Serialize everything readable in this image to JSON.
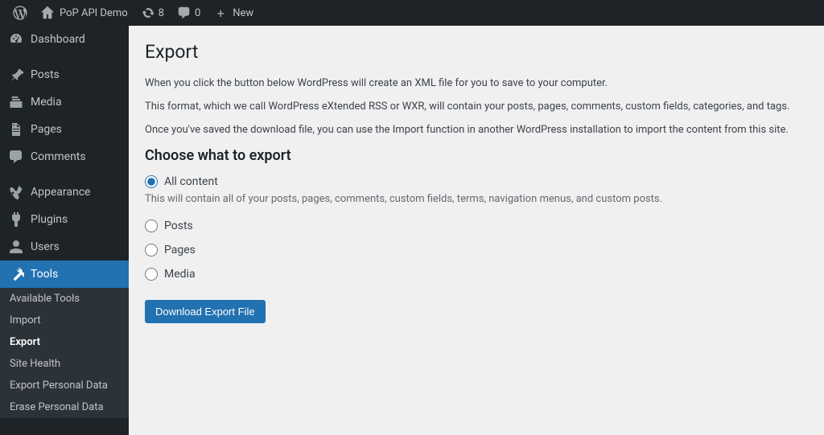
{
  "adminbar": {
    "site_name": "PoP API Demo",
    "updates_count": "8",
    "comments_count": "0",
    "new_label": "New"
  },
  "sidebar": {
    "items": [
      {
        "label": "Dashboard"
      },
      {
        "label": "Posts"
      },
      {
        "label": "Media"
      },
      {
        "label": "Pages"
      },
      {
        "label": "Comments"
      },
      {
        "label": "Appearance"
      },
      {
        "label": "Plugins"
      },
      {
        "label": "Users"
      },
      {
        "label": "Tools"
      }
    ],
    "submenu": [
      {
        "label": "Available Tools"
      },
      {
        "label": "Import"
      },
      {
        "label": "Export"
      },
      {
        "label": "Site Health"
      },
      {
        "label": "Export Personal Data"
      },
      {
        "label": "Erase Personal Data"
      }
    ]
  },
  "main": {
    "title": "Export",
    "para1": "When you click the button below WordPress will create an XML file for you to save to your computer.",
    "para2": "This format, which we call WordPress eXtended RSS or WXR, will contain your posts, pages, comments, custom fields, categories, and tags.",
    "para3": "Once you've saved the download file, you can use the Import function in another WordPress installation to import the content from this site.",
    "section_heading": "Choose what to export",
    "options": {
      "all": "All content",
      "all_help": "This will contain all of your posts, pages, comments, custom fields, terms, navigation menus, and custom posts.",
      "posts": "Posts",
      "pages": "Pages",
      "media": "Media"
    },
    "download_button": "Download Export File"
  }
}
